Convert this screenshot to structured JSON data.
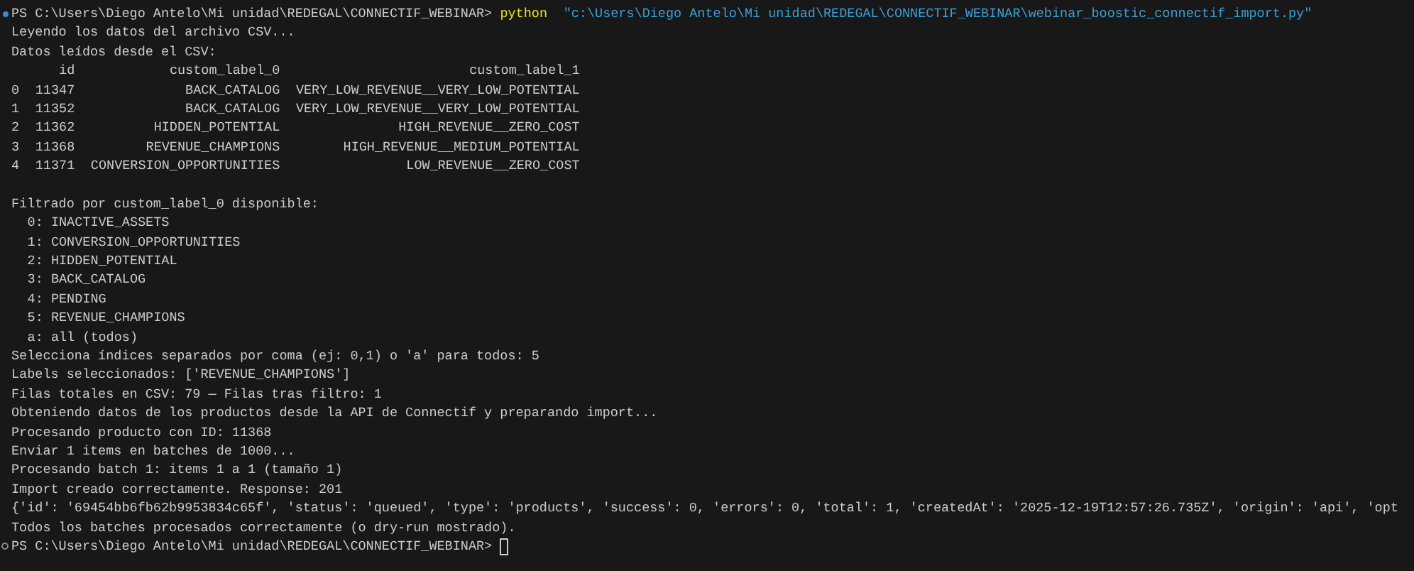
{
  "terminal": {
    "lines": [
      {
        "kind": "prompt",
        "completed": true,
        "prompt": "PS C:\\Users\\Diego Antelo\\Mi unidad\\REDEGAL\\CONNECTIF_WEBINAR>",
        "command": "python",
        "argument": "\"c:\\Users\\Diego Antelo\\Mi unidad\\REDEGAL\\CONNECTIF_WEBINAR\\webinar_boostic_connectif_import.py\"",
        "cursor": false
      },
      {
        "kind": "output",
        "text": "Leyendo los datos del archivo CSV..."
      },
      {
        "kind": "output",
        "text": "Datos leídos desde el CSV:"
      },
      {
        "kind": "table",
        "columns": [
          "id",
          "custom_label_0",
          "custom_label_1"
        ],
        "rows": [
          {
            "index": "0",
            "cells": [
              "11347",
              "BACK_CATALOG",
              "VERY_LOW_REVENUE__VERY_LOW_POTENTIAL"
            ]
          },
          {
            "index": "1",
            "cells": [
              "11352",
              "BACK_CATALOG",
              "VERY_LOW_REVENUE__VERY_LOW_POTENTIAL"
            ]
          },
          {
            "index": "2",
            "cells": [
              "11362",
              "HIDDEN_POTENTIAL",
              "HIGH_REVENUE__ZERO_COST"
            ]
          },
          {
            "index": "3",
            "cells": [
              "11368",
              "REVENUE_CHAMPIONS",
              "HIGH_REVENUE__MEDIUM_POTENTIAL"
            ]
          },
          {
            "index": "4",
            "cells": [
              "11371",
              "CONVERSION_OPPORTUNITIES",
              "LOW_REVENUE__ZERO_COST"
            ]
          }
        ]
      },
      {
        "kind": "blank"
      },
      {
        "kind": "output",
        "text": "Filtrado por custom_label_0 disponible:"
      },
      {
        "kind": "option",
        "text": "0: INACTIVE_ASSETS"
      },
      {
        "kind": "option",
        "text": "1: CONVERSION_OPPORTUNITIES"
      },
      {
        "kind": "option",
        "text": "2: HIDDEN_POTENTIAL"
      },
      {
        "kind": "option",
        "text": "3: BACK_CATALOG"
      },
      {
        "kind": "option",
        "text": "4: PENDING"
      },
      {
        "kind": "option",
        "text": "5: REVENUE_CHAMPIONS"
      },
      {
        "kind": "option",
        "text": "a: all (todos)"
      },
      {
        "kind": "output",
        "text": "Selecciona índices separados por coma (ej: 0,1) o 'a' para todos: 5"
      },
      {
        "kind": "output",
        "text": "Labels seleccionados: ['REVENUE_CHAMPIONS']"
      },
      {
        "kind": "output",
        "text": "Filas totales en CSV: 79 — Filas tras filtro: 1"
      },
      {
        "kind": "output",
        "text": "Obteniendo datos de los productos desde la API de Connectif y preparando import..."
      },
      {
        "kind": "output",
        "text": "Procesando producto con ID: 11368"
      },
      {
        "kind": "output",
        "text": "Enviar 1 items en batches de 1000..."
      },
      {
        "kind": "output",
        "text": "Procesando batch 1: items 1 a 1 (tamaño 1)"
      },
      {
        "kind": "output",
        "text": "Import creado correctamente. Response: 201"
      },
      {
        "kind": "output",
        "text": "{'id': '69454bb6fb62b9953834c65f', 'status': 'queued', 'type': 'products', 'success': 0, 'errors': 0, 'total': 1, 'createdAt': '2025-12-19T12:57:26.735Z', 'origin': 'api', 'opt"
      },
      {
        "kind": "output",
        "text": "Todos los batches procesados correctamente (o dry-run mostrado)."
      },
      {
        "kind": "prompt",
        "completed": false,
        "prompt": "PS C:\\Users\\Diego Antelo\\Mi unidad\\REDEGAL\\CONNECTIF_WEBINAR>",
        "cursor": true
      }
    ]
  }
}
